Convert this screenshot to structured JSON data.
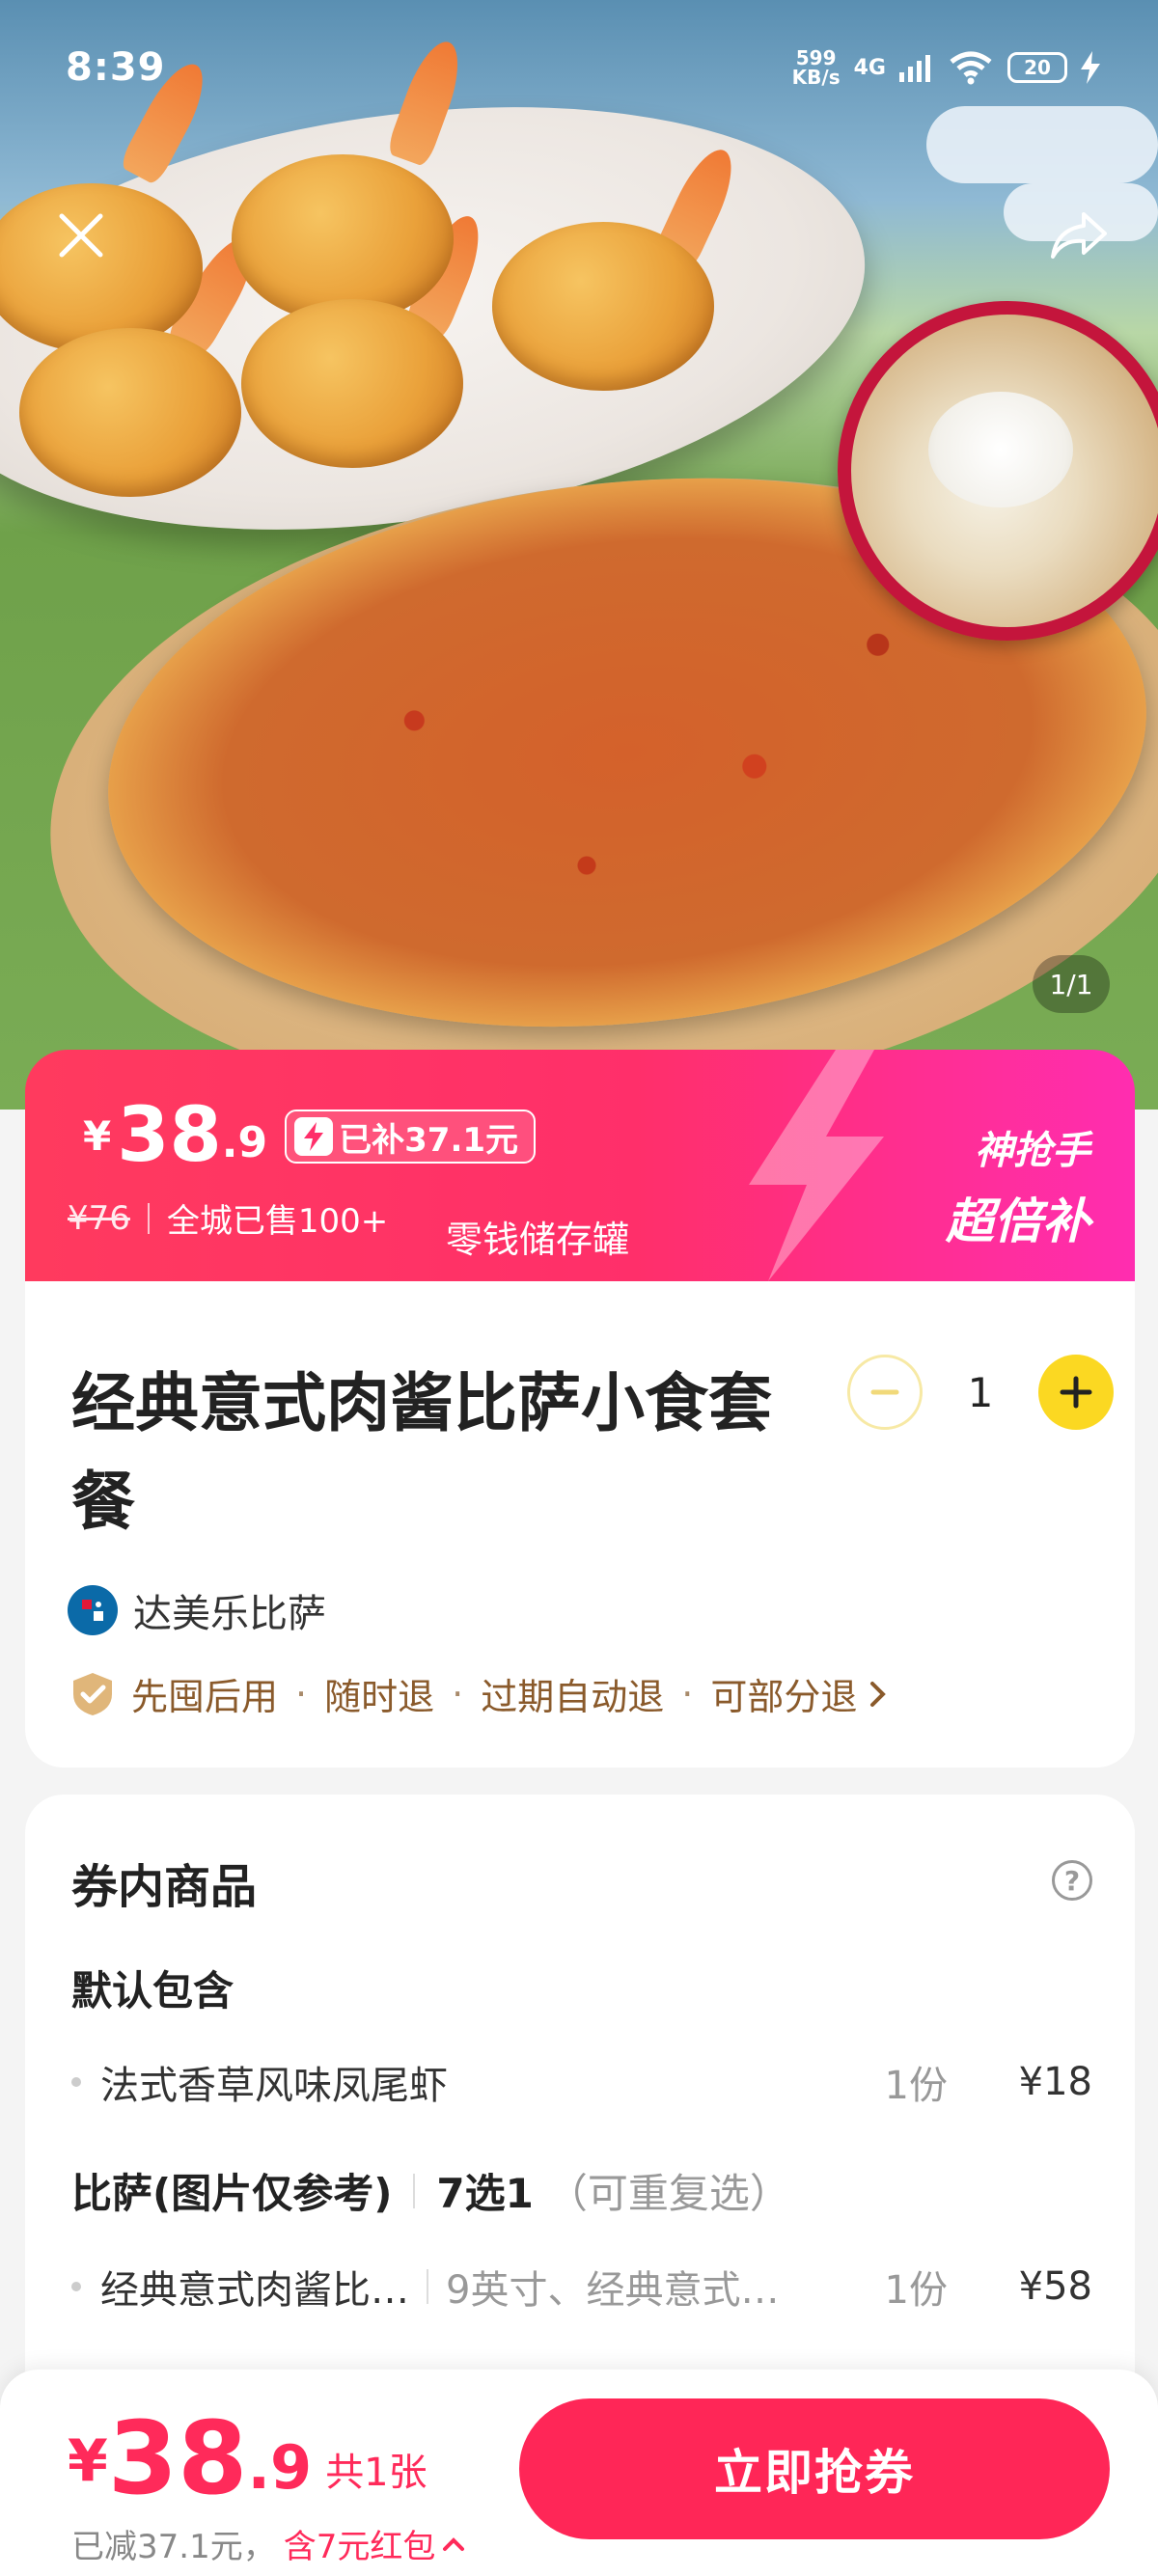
{
  "status_bar": {
    "time": "8:39",
    "net_speed_value": "599",
    "net_speed_unit": "KB/s",
    "network": "4G",
    "battery": "20"
  },
  "hero": {
    "page_indicator": "1/1"
  },
  "price_banner": {
    "currency": "¥",
    "price_int": "38",
    "price_dec": ".9",
    "subsidy": "已补37.1元",
    "original_price": "¥76",
    "sold": "全城已售100+",
    "jar_label": "零钱储存罐",
    "promo_line1": "神抢手",
    "promo_line2": "超倍补"
  },
  "product": {
    "title": "经典意式肉酱比萨小食套餐",
    "quantity": "1",
    "shop_name": "达美乐比萨",
    "guarantees": [
      "先囤后用",
      "随时退",
      "过期自动退",
      "可部分退"
    ]
  },
  "coupon_items": {
    "section_title": "券内商品",
    "groups": [
      {
        "title": "默认包含",
        "extra": "",
        "note": "",
        "rows": [
          {
            "name": "法式香草风味凤尾虾",
            "spec": "",
            "count": "1份",
            "price": "¥18"
          }
        ]
      },
      {
        "title": "比萨(图片仅参考)",
        "extra": "7选1",
        "note": "（可重复选）",
        "rows": [
          {
            "name": "经典意式肉酱比…",
            "spec": "9英寸、经典意式…",
            "count": "1份",
            "price": "¥58"
          }
        ]
      }
    ]
  },
  "bottom_bar": {
    "currency": "¥",
    "total_int": "38",
    "total_dec": ".9",
    "count": "共1张",
    "discount": "已减37.1元，",
    "red_packet": "含7元红包",
    "cta": "立即抢券"
  },
  "colors": {
    "accent": "#ff2657",
    "stepper_plus": "#fbd822",
    "guarantee": "#8a5a2b"
  }
}
